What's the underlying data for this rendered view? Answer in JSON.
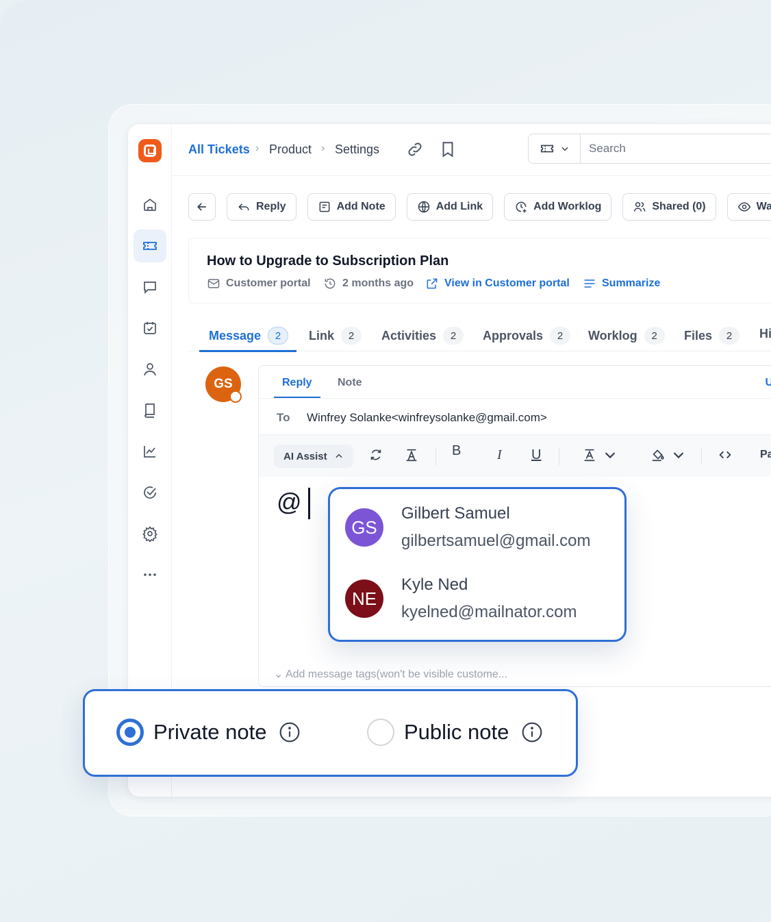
{
  "breadcrumb": [
    "All Tickets",
    "Product",
    "Settings"
  ],
  "search": {
    "placeholder": "Search"
  },
  "toolbar": {
    "reply": "Reply",
    "add_note": "Add Note",
    "add_link": "Add Link",
    "add_worklog": "Add Worklog",
    "shared": "Shared (0)",
    "watchers": "Watchers"
  },
  "ticket": {
    "title": "How to Upgrade to Subscription Plan",
    "source": "Customer portal",
    "time": "2 months ago",
    "view_link": "View in Customer portal",
    "summarize": "Summarize"
  },
  "tabs": [
    {
      "label": "Message",
      "count": "2"
    },
    {
      "label": "Link",
      "count": "2"
    },
    {
      "label": "Activities",
      "count": "2"
    },
    {
      "label": "Approvals",
      "count": "2"
    },
    {
      "label": "Worklog",
      "count": "2"
    },
    {
      "label": "Files",
      "count": "2"
    },
    {
      "label": "Hi",
      "count": ""
    }
  ],
  "author": {
    "initials": "GS",
    "color": "#dc6410"
  },
  "composer": {
    "tabs": [
      "Reply",
      "Note"
    ],
    "right_label": "Us",
    "to_label": "To",
    "to_value": "Winfrey Solanke<winfreysolanke@gmail.com>",
    "ai_assist": "AI Assist",
    "bold": "B",
    "italic": "I",
    "underline": "U",
    "paste_label": "Pa",
    "body_text": "@",
    "tags_placeholder": "Add message tags(won't be visible custome..."
  },
  "mentions": [
    {
      "initials": "GS",
      "name": "Gilbert Samuel",
      "email": "gilbertsamuel@gmail.com",
      "color": "#7b55d6"
    },
    {
      "initials": "NE",
      "name": "Kyle Ned",
      "email": "kyelned@mailnator.com",
      "color": "#7c0f18"
    }
  ],
  "note_type": {
    "private": "Private note",
    "public": "Public note",
    "selected": "private"
  },
  "colors": {
    "accent": "#1d6fd6",
    "brand": "#f05a1a"
  }
}
